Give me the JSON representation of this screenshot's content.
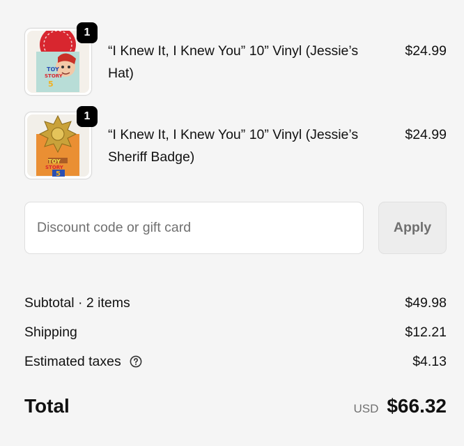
{
  "items": [
    {
      "quantity": "1",
      "title": "“I Knew It, I Knew You” 10” Vinyl (Jessie’s Hat)",
      "price": "$24.99",
      "image_icon": "jessie-hat-vinyl-image"
    },
    {
      "quantity": "1",
      "title": "“I Knew It, I Knew You” 10” Vinyl (Jessie’s Sheriff Badge)",
      "price": "$24.99",
      "image_icon": "sheriff-badge-vinyl-image"
    }
  ],
  "discount": {
    "placeholder": "Discount code or gift card",
    "apply_label": "Apply"
  },
  "summary": {
    "subtotal_label": "Subtotal · 2 items",
    "subtotal_value": "$49.98",
    "shipping_label": "Shipping",
    "shipping_value": "$12.21",
    "taxes_label": "Estimated taxes",
    "taxes_value": "$4.13",
    "help_icon": "question-circle-icon"
  },
  "total": {
    "label": "Total",
    "currency": "USD",
    "amount": "$66.32"
  },
  "colors": {
    "background": "#f5f5f5",
    "badge": "#000000",
    "apply_button_bg": "#ededed",
    "apply_button_text": "#6f6f6f"
  }
}
